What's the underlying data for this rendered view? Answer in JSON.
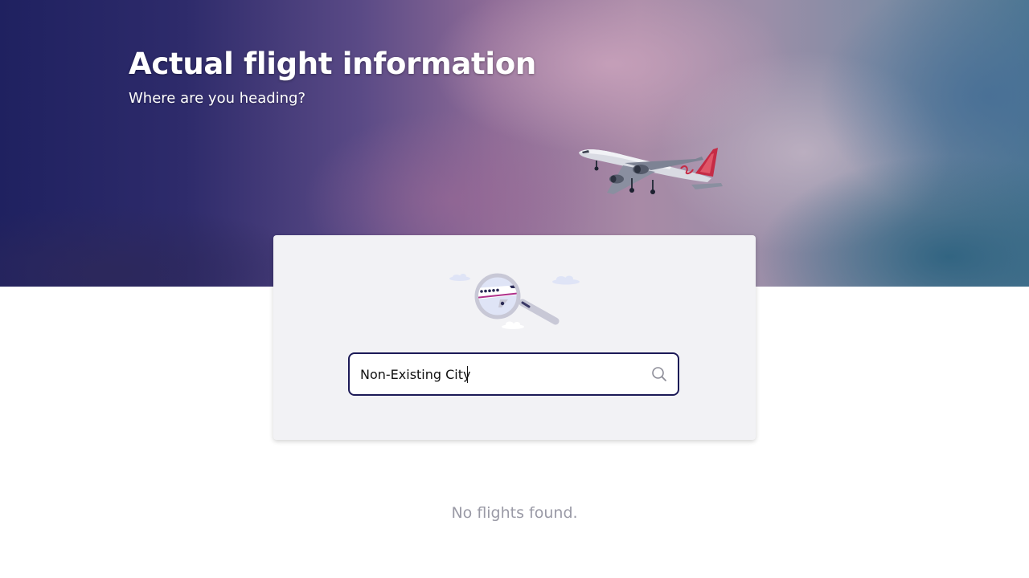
{
  "hero": {
    "title": "Actual flight information",
    "subtitle": "Where are you heading?"
  },
  "search": {
    "value": "Non-Existing City",
    "icon": "search-icon"
  },
  "results": {
    "empty_message": "No flights found."
  },
  "colors": {
    "hero_dark": "#1f2160",
    "input_border": "#1c1a57",
    "card_background": "#f2f2f5",
    "muted_text": "#9a9aa6"
  }
}
